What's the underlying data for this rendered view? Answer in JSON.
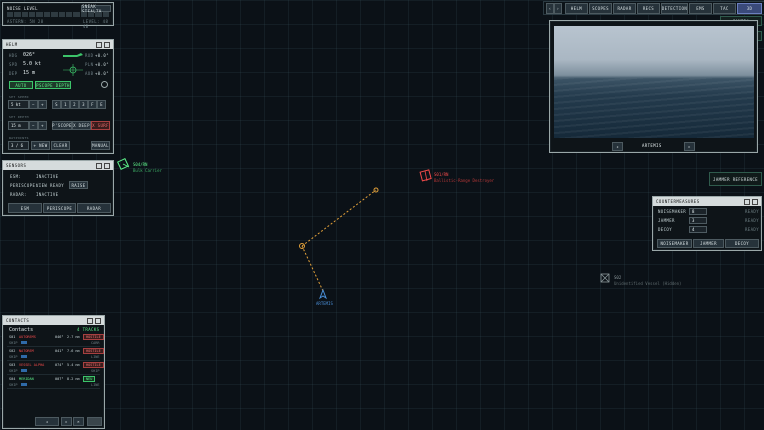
{
  "noise": {
    "label": "NOISE LEVEL",
    "sneak_label": "SNEAK STEALTH",
    "left_text": "ASTERN: 5N 28",
    "right_text": "LEVEL: 48 4B"
  },
  "helm": {
    "title": "HELM",
    "hdg_label": "HDG",
    "hdg_value": "026°",
    "spd_label": "SPD",
    "spd_value": "5.0 kt",
    "dep_label": "DEP",
    "dep_value": "15 m",
    "readouts": [
      {
        "label": "RUD",
        "value": "+0.0°"
      },
      {
        "label": "PLN",
        "value": "+0.0°"
      },
      {
        "label": "AOB",
        "value": "+0.0°"
      }
    ],
    "auto_label": "AUTO",
    "periscope_depth_label": "PSCOPE DEPTH",
    "speed_label": "SET SPEED",
    "speed_value": "5 kt",
    "speed_bells": [
      "S",
      "1",
      "2",
      "3",
      "F",
      "E"
    ],
    "depth_label": "SET DEPTH",
    "depth_value": "15 m",
    "depth_buttons": [
      "P'SCOPE",
      "X DEEP",
      "X SURF"
    ],
    "waypoints_label": "WAYPOINTS",
    "waypoints_value": "3 / 6",
    "new_label": "+ NEW",
    "clear_label": "CLEAR",
    "manual_label": "MANUAL"
  },
  "sensors": {
    "title": "SENSORS",
    "esm_label": "ESM:",
    "esm_value": "INACTIVE",
    "periscope_label": "PERISCOPE:",
    "periscope_value": "VIEW READY",
    "periscope_btn": "RAISE",
    "radar_label": "RADAR:",
    "radar_value": "INACTIVE",
    "buttons": [
      "ESM",
      "PERISCOPE",
      "RADAR"
    ]
  },
  "contacts": {
    "title": "CONTACTS",
    "header_label": "Contacts",
    "count_label": "4 TRACKS",
    "rows": [
      {
        "id": "S01",
        "name": "AUTOREMS",
        "brg": "046°",
        "rng": "2.7 nm",
        "tag": "HOSTILE",
        "sub": "CARR",
        "class_text": "SHIP",
        "ok": false
      },
      {
        "id": "S02",
        "name": "NATOREM",
        "brg": "041°",
        "rng": "7.6 nm",
        "tag": "HOSTILE",
        "sub": "LINE",
        "class_text": "SHIP",
        "ok": false
      },
      {
        "id": "S03",
        "name": "VESSEL ALPHA",
        "brg": "074°",
        "rng": "5.4 nm",
        "tag": "HOSTILE",
        "sub": "SHIP",
        "class_text": "SHIP",
        "ok": false
      },
      {
        "id": "S04",
        "name": "MERIDAN",
        "brg": "007°",
        "rng": "8.2 nm",
        "tag": "NEU",
        "sub": "LINE",
        "class_text": "SHIP",
        "ok": true
      }
    ],
    "footer_buttons": [
      "◂",
      "▸",
      "✕"
    ]
  },
  "nav": {
    "buttons": [
      "‹",
      "›",
      "HELM",
      "SCOPES",
      "RADAR",
      "RECS",
      "DETECTION",
      "EMS",
      "TAC",
      "3D"
    ],
    "active": "3D"
  },
  "view": {
    "sub_buttons": [
      "CAMERA",
      "MESSAGES"
    ],
    "camera_label": "ARTEMIS",
    "prev_label": "◂",
    "next_label": "▸"
  },
  "jammer_toggle": "JAMMER REFERENCE",
  "countermeasures": {
    "title": "COUNTERMEASURES",
    "items": [
      {
        "label": "NOISEMAKER",
        "count": "8",
        "status": "READY"
      },
      {
        "label": "JAMMER",
        "count": "3",
        "status": "READY"
      },
      {
        "label": "DECOY",
        "count": "4",
        "status": "READY"
      }
    ],
    "buttons": [
      "NOISEMAKER",
      "JAMMER",
      "DECOY"
    ]
  },
  "map": {
    "own_ship": "ARTEMIS",
    "contact_green_id": "S04/RN",
    "contact_green_desc": "Bulk Carrier",
    "contact_red_id": "S01/RN",
    "contact_red_desc": "Ballistic-Range Destroyer",
    "contact_grey_id": "S02",
    "contact_grey_desc": "Unidentified Vessel (Hidden)"
  },
  "colors": {
    "hostile": "#f04a4a",
    "neutral": "#5ef08a",
    "waypoint": "#e3a13a",
    "own": "#4a8fd8"
  }
}
